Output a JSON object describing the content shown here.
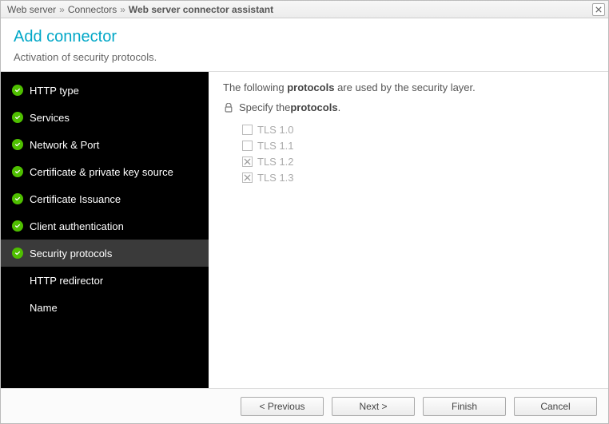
{
  "breadcrumb": {
    "a": "Web server",
    "b": "Connectors",
    "c": "Web server connector assistant"
  },
  "header": {
    "title": "Add connector",
    "subtitle": "Activation of security protocols."
  },
  "sidebar": {
    "items": [
      {
        "label": "HTTP type",
        "done": true
      },
      {
        "label": "Services",
        "done": true
      },
      {
        "label": "Network & Port",
        "done": true
      },
      {
        "label": "Certificate & private key source",
        "done": true
      },
      {
        "label": "Certificate Issuance",
        "done": true
      },
      {
        "label": "Client authentication",
        "done": true
      },
      {
        "label": "Security protocols",
        "done": true,
        "active": true
      },
      {
        "label": "HTTP redirector",
        "done": false
      },
      {
        "label": "Name",
        "done": false
      }
    ]
  },
  "content": {
    "line1_a": "The following ",
    "line1_b": "protocols",
    "line1_c": " are used by the security layer.",
    "spec_a": "Specify the ",
    "spec_b": "protocols",
    "spec_c": ".",
    "options": [
      {
        "label": "TLS 1.0",
        "checked": false
      },
      {
        "label": "TLS 1.1",
        "checked": false
      },
      {
        "label": "TLS 1.2",
        "checked": true
      },
      {
        "label": "TLS 1.3",
        "checked": true
      }
    ]
  },
  "buttons": {
    "previous": "< Previous",
    "next": "Next >",
    "finish": "Finish",
    "cancel": "Cancel"
  }
}
